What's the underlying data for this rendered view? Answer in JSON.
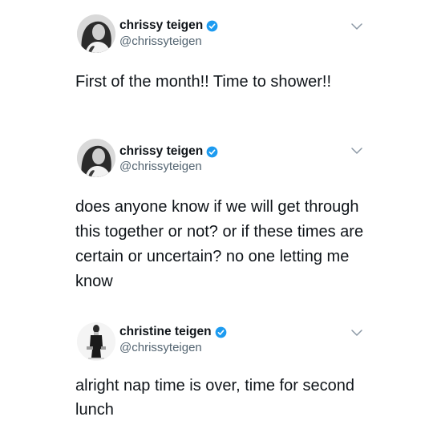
{
  "tweets": [
    {
      "display_name": "chrissy teigen",
      "handle": "@chrissyteigen",
      "text": "First of the month!! Time to shower!!",
      "verified": true,
      "avatar_icon": "portrait-avatar-icon",
      "menu_icon": "chevron-down-icon"
    },
    {
      "display_name": "chrissy teigen",
      "handle": "@chrissyteigen",
      "text": "does anyone know if we will get through this together or not? or if these times are certain or uncertain? no one letting me know",
      "verified": true,
      "avatar_icon": "portrait-avatar-icon",
      "menu_icon": "chevron-down-icon"
    },
    {
      "display_name": "christine teigen",
      "handle": "@chrissyteigen",
      "text": "alright nap time is over, time for second lunch",
      "verified": true,
      "avatar_icon": "full-body-avatar-icon",
      "menu_icon": "chevron-down-icon"
    }
  ],
  "colors": {
    "text": "#0f1419",
    "handle": "#536471",
    "verified_badge": "#1d9bf0",
    "chevron": "#8b98a5"
  }
}
